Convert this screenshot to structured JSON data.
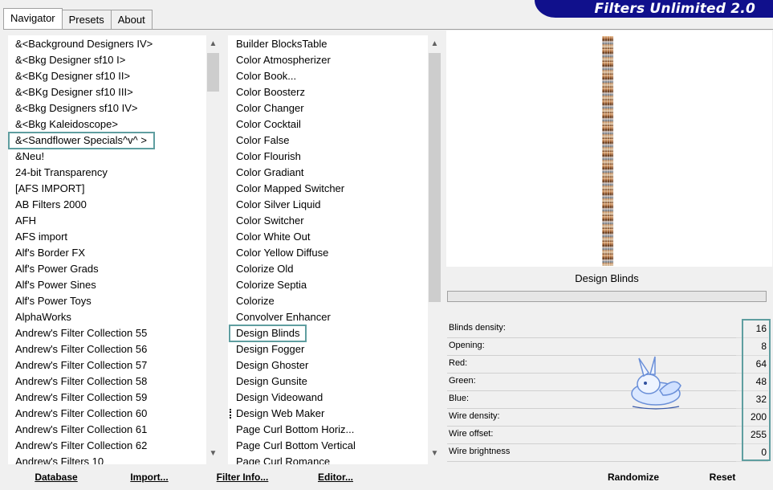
{
  "banner": {
    "title": "Filters Unlimited 2.0"
  },
  "tabs": [
    "Navigator",
    "Presets",
    "About"
  ],
  "categories": [
    "&<Background Designers IV>",
    "&<Bkg Designer sf10 I>",
    "&<BKg Designer sf10 II>",
    "&<BKg Designer sf10 III>",
    "&<Bkg Designers sf10 IV>",
    "&<Bkg Kaleidoscope>",
    "&<Sandflower Specials^v^ >",
    "&Neu!",
    "24-bit Transparency",
    "[AFS IMPORT]",
    "AB Filters 2000",
    "AFH",
    "AFS import",
    "Alf's Border FX",
    "Alf's Power Grads",
    "Alf's Power Sines",
    "Alf's Power Toys",
    "AlphaWorks",
    "Andrew's Filter Collection 55",
    "Andrew's Filter Collection 56",
    "Andrew's Filter Collection 57",
    "Andrew's Filter Collection 58",
    "Andrew's Filter Collection 59",
    "Andrew's Filter Collection 60",
    "Andrew's Filter Collection 61",
    "Andrew's Filter Collection 62",
    "Andrew's Filters 10"
  ],
  "filters": [
    "Builder BlocksTable",
    "Color Atmospherizer",
    "Color Book...",
    "Color Boosterz",
    "Color Changer",
    "Color Cocktail",
    "Color False",
    "Color Flourish",
    "Color Gradiant",
    "Color Mapped Switcher",
    "Color Silver Liquid",
    "Color Switcher",
    "Color White Out",
    "Color Yellow Diffuse",
    "Colorize Old",
    "Colorize Septia",
    "Colorize",
    "Convolver Enhancer",
    "Design Blinds",
    "Design Fogger",
    "Design Ghoster",
    "Design Gunsite",
    "Design Videowand",
    "Design Web Maker",
    "Page Curl Bottom Horiz...",
    "Page Curl Bottom Vertical",
    "Page Curl Romance"
  ],
  "selected_filter": "Design Blinds",
  "params": [
    {
      "label": "Blinds density:",
      "value": "16"
    },
    {
      "label": "Opening:",
      "value": "8"
    },
    {
      "label": "Red:",
      "value": "64"
    },
    {
      "label": "Green:",
      "value": "48"
    },
    {
      "label": "Blue:",
      "value": "32"
    },
    {
      "label": "Wire density:",
      "value": "200"
    },
    {
      "label": "Wire offset:",
      "value": "255"
    },
    {
      "label": "Wire brightness",
      "value": "0"
    }
  ],
  "buttons": {
    "database": "Database",
    "import": "Import...",
    "filter_info": "Filter Info...",
    "editor": "Editor...",
    "randomize": "Randomize",
    "reset": "Reset"
  },
  "colors": {
    "banner": "#10108c",
    "highlight_box": "#5f9ea0"
  },
  "icons": [
    "scroll-up-icon",
    "scroll-down-icon",
    "bunny-logo-icon"
  ]
}
